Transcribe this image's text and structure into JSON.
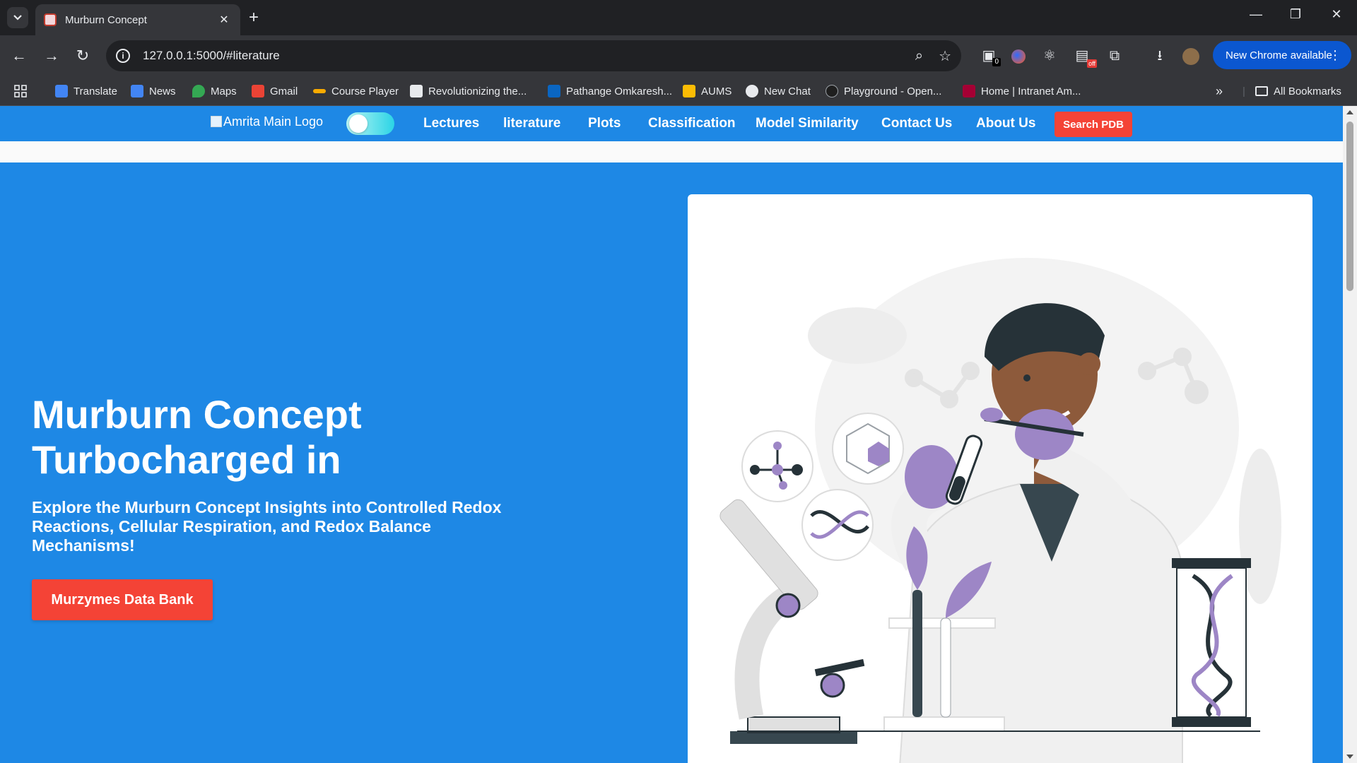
{
  "browser": {
    "tab_title": "Murburn Concept",
    "tab_close": "✕",
    "new_tab": "+",
    "url": "127.0.0.1:5000/#literature",
    "new_chrome_label": "New Chrome available",
    "extension_badge_count": "0",
    "extension_badge_off": "off",
    "all_bookmarks": "All Bookmarks"
  },
  "bookmarks": [
    {
      "label": "Translate",
      "color": "#4285f4"
    },
    {
      "label": "News",
      "color": "#4285f4"
    },
    {
      "label": "Maps",
      "color": "#34a853"
    },
    {
      "label": "Gmail",
      "color": "#ea4335"
    },
    {
      "label": "Course Player",
      "color": "#f9ab00"
    },
    {
      "label": "Revolutionizing the...",
      "color": "#e8eaed"
    },
    {
      "label": "Pathange Omkaresh...",
      "color": "#0a66c2"
    },
    {
      "label": "AUMS",
      "color": "#fbbc04"
    },
    {
      "label": "New Chat",
      "color": "#e8eaed"
    },
    {
      "label": "Playground - Open...",
      "color": "#1f1f1f"
    },
    {
      "label": "Home | Intranet Am...",
      "color": "#a50034"
    }
  ],
  "nav": {
    "logo_alt": "Amrita Main Logo",
    "links": [
      "Lectures",
      "literature",
      "Plots",
      "Classification",
      "Model Similarity",
      "Contact Us",
      "About Us"
    ],
    "search_button": "Search PDB"
  },
  "hero": {
    "title_line1": "Murburn Concept",
    "title_line2": "Turbocharged in",
    "subtitle": "Explore the Murburn Concept Insights into Controlled Redox Reactions, Cellular Respiration, and Redox Balance Mechanisms!",
    "button": "Murzymes Data Bank"
  },
  "colors": {
    "primary": "#1e88e5",
    "accent": "#f44336",
    "illustration_purple": "#9d86c6"
  }
}
